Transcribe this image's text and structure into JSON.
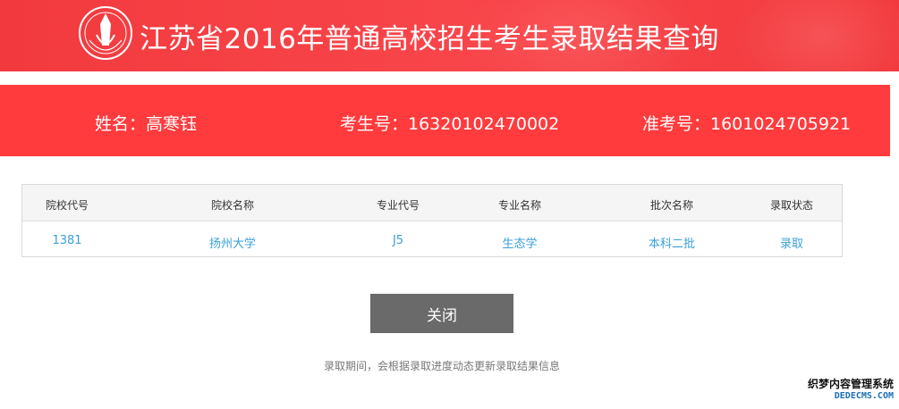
{
  "header": {
    "title": "江苏省2016年普通高校招生考生录取结果查询"
  },
  "student": {
    "name": "姓名：高寒钰",
    "exam_number": "考生号：16320102470002",
    "admission_number": "准考号：1601024705921"
  },
  "table": {
    "columns": [
      "院校代号",
      "院校名称",
      "专业代号",
      "专业名称",
      "批次名称",
      "录取状态"
    ],
    "rows": [
      [
        "1381",
        "扬州大学",
        "J5",
        "生态学",
        "本科二批",
        "录取"
      ]
    ]
  },
  "actions": {
    "close_label": "关闭"
  },
  "notice": "录取期间，会根据录取进度动态更新录取结果信息",
  "watermark": {
    "line1": "织梦内容管理系统",
    "line2": "DEDECMS.COM"
  },
  "colors": {
    "banner_red": "#f23a3e",
    "info_bar_red": "#ff3b3d",
    "link_blue": "#3aa0d8",
    "button_gray": "#6a6a6a"
  }
}
